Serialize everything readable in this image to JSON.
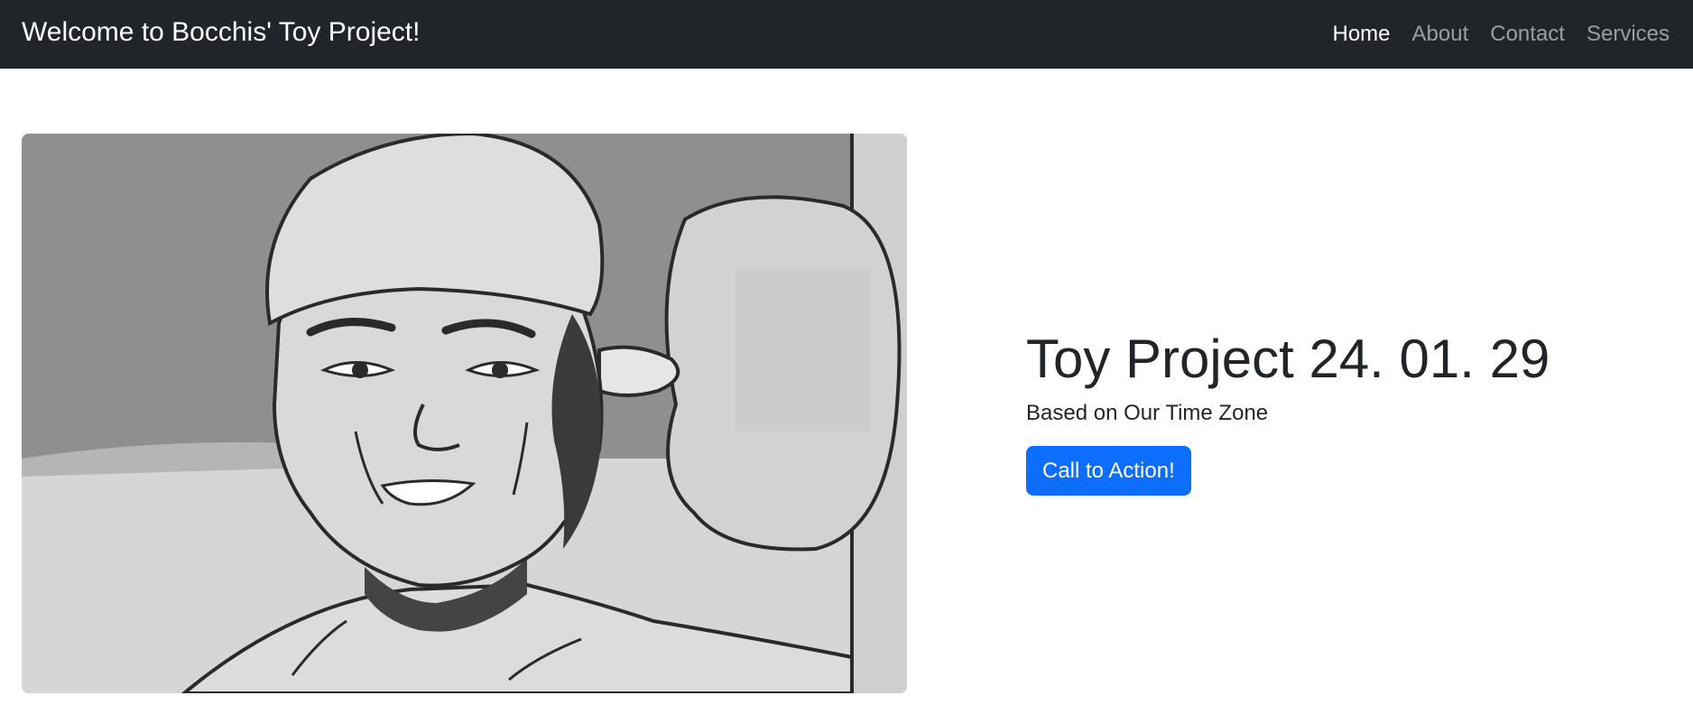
{
  "navbar": {
    "brand": "Welcome to Bocchis' Toy Project!",
    "links": [
      {
        "label": "Home",
        "active": true
      },
      {
        "label": "About",
        "active": false
      },
      {
        "label": "Contact",
        "active": false
      },
      {
        "label": "Services",
        "active": false
      }
    ],
    "background_color": "#212529"
  },
  "hero": {
    "image": {
      "description_icon": "manga-illustration",
      "style": "grayscale"
    },
    "title": "Toy Project 24. 01. 29",
    "subtitle": "Based on Our Time Zone",
    "cta_label": "Call to Action!",
    "cta_color": "#0d6efd"
  }
}
